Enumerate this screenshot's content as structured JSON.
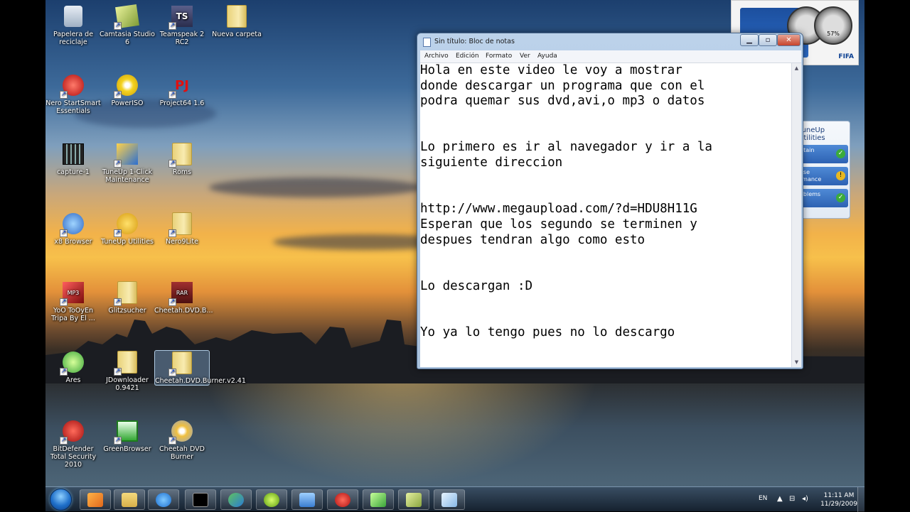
{
  "desktop_icons": [
    {
      "label": "Papelera de reciclaje",
      "icon": "recycle-bin-icon"
    },
    {
      "label": "Camtasia Studio 6",
      "icon": "camtasia-icon"
    },
    {
      "label": "Teamspeak 2 RC2",
      "icon": "teamspeak-icon"
    },
    {
      "label": "Nueva carpeta",
      "icon": "folder-icon"
    },
    {
      "label": "Nero StartSmart Essentials",
      "icon": "nero-icon"
    },
    {
      "label": "PowerISO",
      "icon": "poweriso-icon"
    },
    {
      "label": "Project64 1.6",
      "icon": "project64-icon"
    },
    {
      "label": "capture-1",
      "icon": "video-file-icon"
    },
    {
      "label": "TuneUp 1-Click Maintenance",
      "icon": "tuneup-maintenance-icon"
    },
    {
      "label": "Roms",
      "icon": "folder-icon"
    },
    {
      "label": "x8 Browser",
      "icon": "browser-icon"
    },
    {
      "label": "TuneUp Utilities",
      "icon": "tuneup-utilities-icon"
    },
    {
      "label": "Nero9Lite",
      "icon": "folder-icon"
    },
    {
      "label": "YoO ToOyEn Tripa By El ...",
      "icon": "mp3-icon"
    },
    {
      "label": "Glitzsucher",
      "icon": "folder-icon"
    },
    {
      "label": "Cheetah.DVD.B...",
      "icon": "rar-icon"
    },
    {
      "label": "Ares",
      "icon": "ares-icon"
    },
    {
      "label": "JDownloader 0.9421",
      "icon": "folder-icon"
    },
    {
      "label": "Cheetah.DVD.Burner.v2.41",
      "icon": "folder-icon"
    },
    {
      "label": "BitDefender Total Security 2010",
      "icon": "bitdefender-icon"
    },
    {
      "label": "GreenBrowser",
      "icon": "greenbrowser-icon"
    },
    {
      "label": "Cheetah DVD Burner",
      "icon": "cheetah-dvd-icon"
    }
  ],
  "notepad": {
    "title": "Sin título: Bloc de notas",
    "menu": [
      "Archivo",
      "Edición",
      "Formato",
      "Ver",
      "Ayuda"
    ],
    "lines": [
      "Hola en este video le voy a mostrar",
      "donde descargar un programa que con el",
      "podra quemar sus dvd,avi,o mp3 o datos",
      "",
      "",
      "Lo primero es ir al navegador y ir a la",
      "siguiente direccion",
      "",
      "",
      "http://www.megaupload.com/?d=HDU8H11G",
      "Esperan que los segundo se terminen y",
      "despues tendran algo como esto",
      "",
      "",
      "Lo descargan :D",
      "",
      "",
      "Yo ya lo tengo pues no lo descargo"
    ]
  },
  "fifa_widget": {
    "gauge_value": "57%",
    "label": "FIFA"
  },
  "tuneup_widget": {
    "title": "TuneUp Utilities",
    "items": [
      "ntain\nn",
      "ase\nrmance",
      "oblems"
    ]
  },
  "taskbar": {
    "language": "EN",
    "time": "11:11 AM",
    "date": "11/29/2009"
  },
  "colors": {
    "accent": "#2d62b3",
    "taskbar": "#223244"
  }
}
